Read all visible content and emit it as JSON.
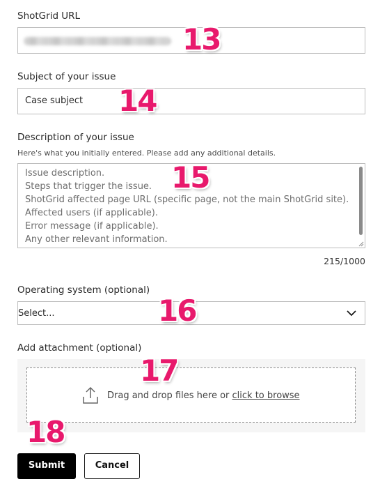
{
  "url_field": {
    "label": "ShotGrid URL"
  },
  "subject_field": {
    "label": "Subject of your issue",
    "value": "Case subject"
  },
  "description_field": {
    "label": "Description of your issue",
    "helper": "Here's what you initially entered. Please add any additional details.",
    "lines": [
      "Issue description.",
      "Steps that trigger the issue.",
      "ShotGrid affected page URL (specific page, not the main ShotGrid site).",
      "Affected users (if applicable).",
      "Error message (if applicable).",
      "Any other relevant information."
    ],
    "counter": "215/1000"
  },
  "os_field": {
    "label": "Operating system (optional)",
    "selected": "Select..."
  },
  "attachment": {
    "label": "Add attachment (optional)",
    "prompt": "Drag and drop files here or",
    "browse_link": "click to browse"
  },
  "buttons": {
    "submit": "Submit",
    "cancel": "Cancel"
  },
  "annotations": {
    "n13": "13",
    "n14": "14",
    "n15": "15",
    "n16": "16",
    "n17": "17",
    "n18": "18"
  },
  "colors": {
    "annotation": "#e8196c",
    "primary_button": "#000000",
    "border": "#bcbcbc"
  }
}
